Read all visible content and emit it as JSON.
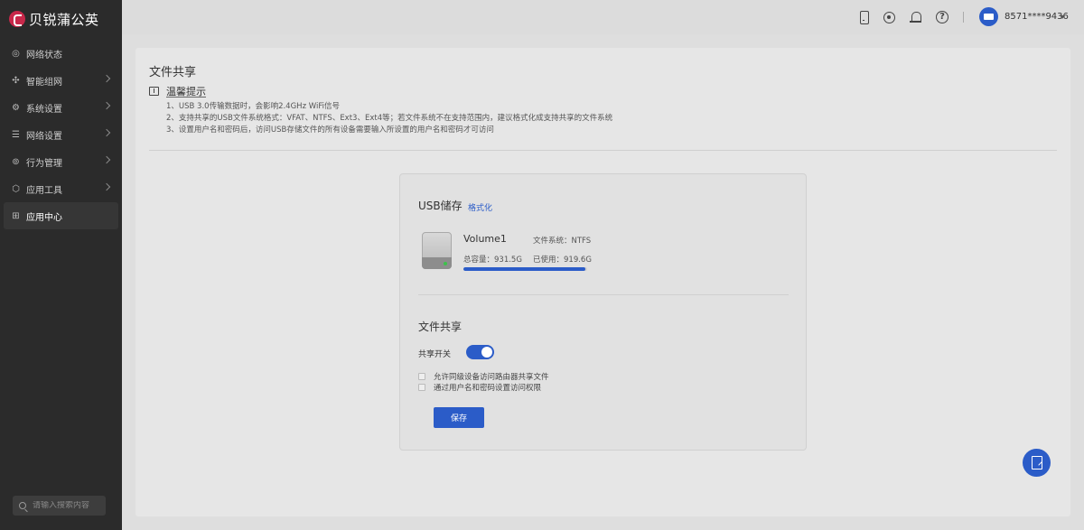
{
  "brand": {
    "name": "贝锐蒲公英"
  },
  "sidebar": {
    "items": [
      {
        "label": "网络状态",
        "icon": "globe-icon",
        "has_submenu": false,
        "active": false
      },
      {
        "label": "智能组网",
        "icon": "network-icon",
        "has_submenu": true,
        "active": false
      },
      {
        "label": "系统设置",
        "icon": "gear-icon",
        "has_submenu": true,
        "active": false
      },
      {
        "label": "网络设置",
        "icon": "sliders-icon",
        "has_submenu": true,
        "active": false
      },
      {
        "label": "行为管理",
        "icon": "behavior-icon",
        "has_submenu": true,
        "active": false
      },
      {
        "label": "应用工具",
        "icon": "tools-icon",
        "has_submenu": true,
        "active": false
      },
      {
        "label": "应用中心",
        "icon": "grid-icon",
        "has_submenu": false,
        "active": true
      }
    ],
    "search_placeholder": "请输入搜索内容"
  },
  "topbar": {
    "icons": [
      "phone-icon",
      "robot-icon",
      "bell-icon",
      "help-icon"
    ],
    "user": "8571****9436"
  },
  "page": {
    "title": "文件共享",
    "tip_title": "温馨提示",
    "tips": [
      "1、USB 3.0传输数据时，会影响2.4GHz WiFi信号",
      "2、支持共享的USB文件系统格式：VFAT、NTFS、Ext3、Ext4等；若文件系统不在支持范围内，建议格式化成支持共享的文件系统",
      "3、设置用户名和密码后，访问USB存储文件的所有设备需要输入所设置的用户名和密码才可访问"
    ]
  },
  "usb": {
    "title": "USB储存",
    "format_link": "格式化",
    "volume": "Volume1",
    "filesystem": "文件系统：NTFS",
    "total": "总容量：931.5G",
    "used": "已使用：919.6G",
    "used_fraction": 0.987
  },
  "share": {
    "title": "文件共享",
    "switch_label": "共享开关",
    "switch_on": true,
    "option1": "允许同级设备访问路由器共享文件",
    "option2": "通过用户名和密码设置访问权限",
    "save": "保存"
  },
  "colors": {
    "accent": "#2b5cc8",
    "sidebar_bg": "#2b2b2b"
  }
}
